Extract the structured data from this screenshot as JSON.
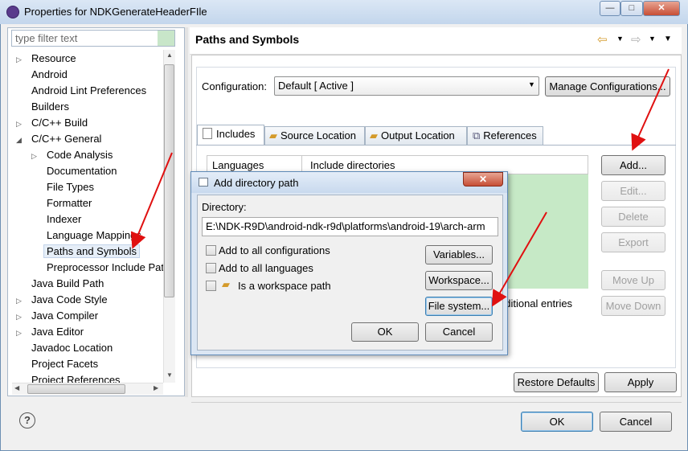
{
  "window": {
    "title": "Properties for NDKGenerateHeaderFIle",
    "controls": [
      "—",
      "□",
      "✕"
    ]
  },
  "filter": {
    "placeholder": "type filter text"
  },
  "tree": [
    {
      "label": "Resource",
      "twisty": "▷",
      "indent": 0
    },
    {
      "label": "Android",
      "twisty": "",
      "indent": 0
    },
    {
      "label": "Android Lint Preferences",
      "twisty": "",
      "indent": 0
    },
    {
      "label": "Builders",
      "twisty": "",
      "indent": 0
    },
    {
      "label": "C/C++ Build",
      "twisty": "▷",
      "indent": 0
    },
    {
      "label": "C/C++ General",
      "twisty": "◢",
      "indent": 0
    },
    {
      "label": "Code Analysis",
      "twisty": "▷",
      "indent": 1
    },
    {
      "label": "Documentation",
      "twisty": "",
      "indent": 1
    },
    {
      "label": "File Types",
      "twisty": "",
      "indent": 1
    },
    {
      "label": "Formatter",
      "twisty": "",
      "indent": 1
    },
    {
      "label": "Indexer",
      "twisty": "",
      "indent": 1
    },
    {
      "label": "Language Mappings",
      "twisty": "",
      "indent": 1
    },
    {
      "label": "Paths and Symbols",
      "twisty": "",
      "indent": 1,
      "selected": true
    },
    {
      "label": "Preprocessor Include Pat",
      "twisty": "",
      "indent": 1
    },
    {
      "label": "Java Build Path",
      "twisty": "",
      "indent": 0
    },
    {
      "label": "Java Code Style",
      "twisty": "▷",
      "indent": 0
    },
    {
      "label": "Java Compiler",
      "twisty": "▷",
      "indent": 0
    },
    {
      "label": "Java Editor",
      "twisty": "▷",
      "indent": 0
    },
    {
      "label": "Javadoc Location",
      "twisty": "",
      "indent": 0
    },
    {
      "label": "Project Facets",
      "twisty": "",
      "indent": 0
    },
    {
      "label": "Project References",
      "twisty": "",
      "indent": 0
    }
  ],
  "page": {
    "title": "Paths and Symbols",
    "configuration_label": "Configuration:",
    "configuration_value": "Default  [ Active ]",
    "manage_button": "Manage Configurations...",
    "tabs": [
      "Includes",
      "Source Location",
      "Output Location",
      "References"
    ],
    "table": {
      "col1": "Languages",
      "col2": "Include directories"
    },
    "side_buttons": [
      {
        "label": "Add...",
        "enabled": true
      },
      {
        "label": "Edit...",
        "enabled": false
      },
      {
        "label": "Delete",
        "enabled": false
      },
      {
        "label": "Export",
        "enabled": false
      },
      {
        "label": "Move Up",
        "enabled": false
      },
      {
        "label": "Move Down",
        "enabled": false
      }
    ],
    "additional_entries_text": "dditional entries",
    "restore_defaults": "Restore Defaults",
    "apply": "Apply"
  },
  "dialog": {
    "title": "Add directory path",
    "directory_label": "Directory:",
    "directory_value": "E:\\NDK-R9D\\android-ndk-r9d\\platforms\\android-19\\arch-arm",
    "checkboxes": [
      {
        "label": "Add to all configurations",
        "checked": false
      },
      {
        "label": "Add to all languages",
        "checked": false
      },
      {
        "label": "Is a workspace path",
        "checked": false
      }
    ],
    "variables_button": "Variables...",
    "workspace_button": "Workspace...",
    "filesystem_button": "File system...",
    "ok": "OK",
    "cancel": "Cancel"
  },
  "footer": {
    "ok": "OK",
    "cancel": "Cancel",
    "help": "?"
  },
  "colors": {
    "arrow": "#e01010",
    "table_green": "#c6e9c6",
    "selection": "#e6eef8"
  }
}
